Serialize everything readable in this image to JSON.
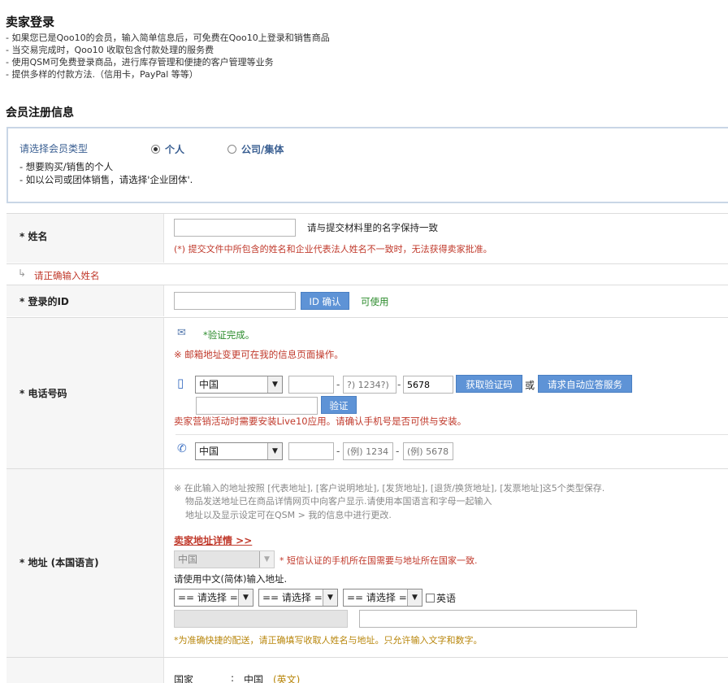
{
  "header": {
    "title": "卖家登录",
    "bullets": [
      "- 如果您已是Qoo10的会员，输入简单信息后，可免费在Qoo10上登录和销售商品",
      "- 当交易完成时，Qoo10 收取包含付款处理的服务费",
      "- 使用QSM可免费登录商品，进行库存管理和便捷的客户管理等业务",
      "- 提供多样的付款方法.（信用卡，PayPal 等等）"
    ]
  },
  "section_title": "会员注册信息",
  "member_type": {
    "label": "请选择会员类型",
    "option_personal": "个人",
    "option_company": "公司/集体",
    "note1": "- 想要购买/销售的个人",
    "note2": "- 如以公司或团体销售，请选择'企业团体'."
  },
  "name": {
    "label": "* 姓名",
    "hint": "请与提交材料里的名字保持一致",
    "warning": "(*) 提交文件中所包含的姓名和企业代表法人姓名不一致时，无法获得卖家批准。",
    "error": "请正确输入姓名"
  },
  "login_id": {
    "label": "* 登录的ID",
    "button": "ID 确认",
    "status": "可使用"
  },
  "phone": {
    "label": "* 电话号码",
    "verified": "*验证完成。",
    "email_note": "※ 邮箱地址变更可在我的信息页面操作。",
    "mobile_country": "中国",
    "mobile_ph2": "?) 1234?)",
    "mobile_val3": "5678",
    "get_code": "获取验证码",
    "or": "或",
    "auto_service": "请求自动应答服务",
    "verify": "验证",
    "app_note": "卖家营销活动时需要安装Live10应用。请确认手机号是否可供与安装。",
    "tel_country": "中国",
    "tel_ph2": "(例) 1234",
    "tel_ph3": "(例) 5678"
  },
  "address": {
    "label": "* 地址 (本国语言)",
    "note1": "※ 在此输入的地址按照 [代表地址], [客户说明地址], [发货地址], [退货/换货地址], [发票地址]这5个类型保存.",
    "note2": "物品发送地址已在商品详情网页中向客户显示.请使用本国语言和字母一起输入",
    "note3": "地址以及显示设定可在QSM > 我的信息中进行更改.",
    "detail_link": "卖家地址详情 >>",
    "country": "中国",
    "country_note": "* 短信认证的手机所在国需要与地址所在国家一致.",
    "input_hint": "请使用中文(简体)输入地址.",
    "select1": "== 请选择 ==",
    "select2": "== 请选择 ==",
    "select3": "== 请选择 ==",
    "english": "英语",
    "footer_note": "*为准确快捷的配送，请正确填写收取人姓名与地址。只允许输入文字和数字。"
  },
  "summary": {
    "country_label": "国家",
    "colon": ":",
    "country_value": "中国",
    "english_tag": "(英文)"
  }
}
